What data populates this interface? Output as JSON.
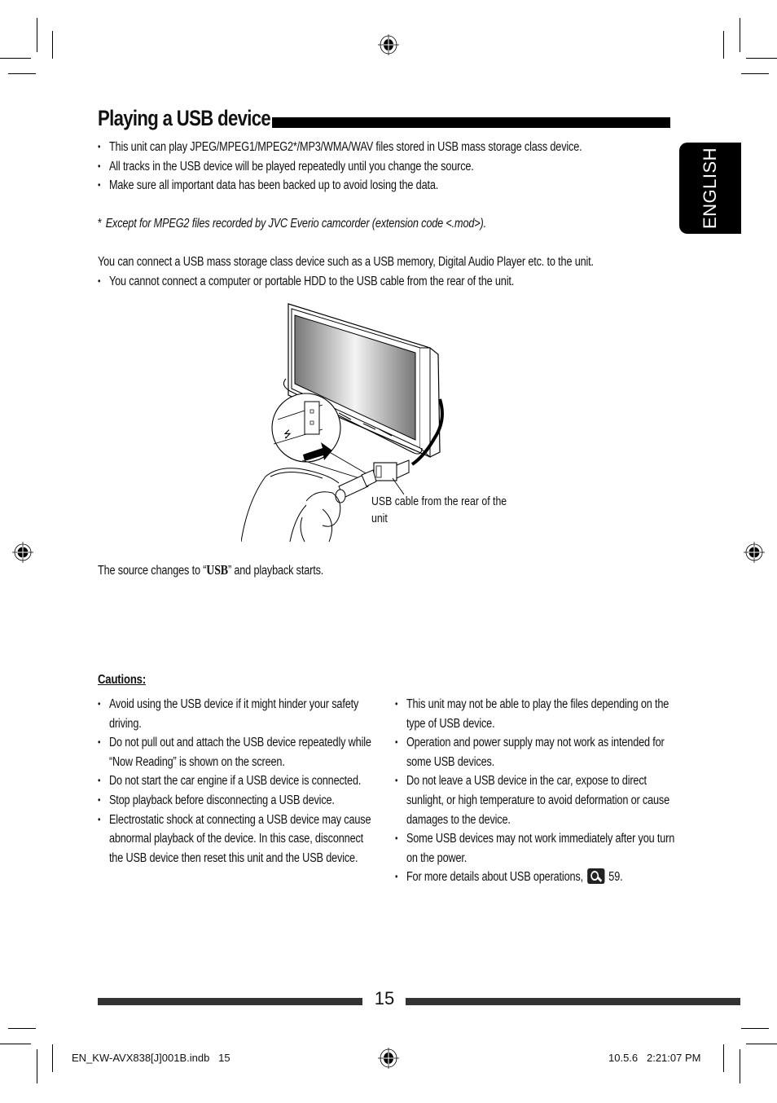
{
  "page": {
    "title": "Playing a USB device",
    "language_tab": "ENGLISH",
    "intro_bullets": [
      "This unit can play JPEG/MPEG1/MPEG2*/MP3/WMA/WAV files stored in USB mass storage class device.",
      "All tracks in the USB device will be played repeatedly until you change the source.",
      "Make sure all important data has been backed up to avoid losing the data."
    ],
    "footnote": {
      "marker": "*",
      "text": "Except for MPEG2 files recorded by JVC Everio camcorder (extension code <.mod>)."
    },
    "connect_paragraph": "You can connect a USB mass storage class device such as a USB memory, Digital Audio Player etc. to the unit.",
    "connect_bullets": [
      "You cannot connect a computer or portable HDD to the USB cable from the rear of the unit."
    ],
    "illustration": {
      "caption": "USB cable from the rear of the unit"
    },
    "source_line": {
      "before": "The source changes to “",
      "emphasis": "USB",
      "after": "” and playback starts."
    },
    "cautions": {
      "heading": "Cautions:",
      "left": [
        "Avoid using the USB device if it might hinder your safety driving.",
        "Do not pull out and attach the USB device repeatedly while “Now Reading” is shown on the screen.",
        "Do not start the car engine if a USB device is connected.",
        "Stop playback before disconnecting a USB device.",
        "Electrostatic shock at connecting a USB device may cause abnormal playback of the device. In this case, disconnect the USB device then reset this unit and the USB device."
      ],
      "right": [
        "This unit may not be able to play the files depending on the type of USB device.",
        "Operation and power supply may not work as intended for some USB devices.",
        "Do not leave a USB device in the car, expose to direct sunlight, or high temperature to avoid deformation or cause damages to the device.",
        "Some USB devices may not work immediately after you turn on the power."
      ],
      "right_last": {
        "text": "For more details about USB operations,",
        "icon": "magnifier-reference-icon",
        "page_ref": "59."
      }
    },
    "page_number": "15",
    "slug": {
      "file": "EN_KW-AVX838[J]001B.indb   15",
      "timestamp": "10.5.6   2:21:07 PM"
    }
  }
}
